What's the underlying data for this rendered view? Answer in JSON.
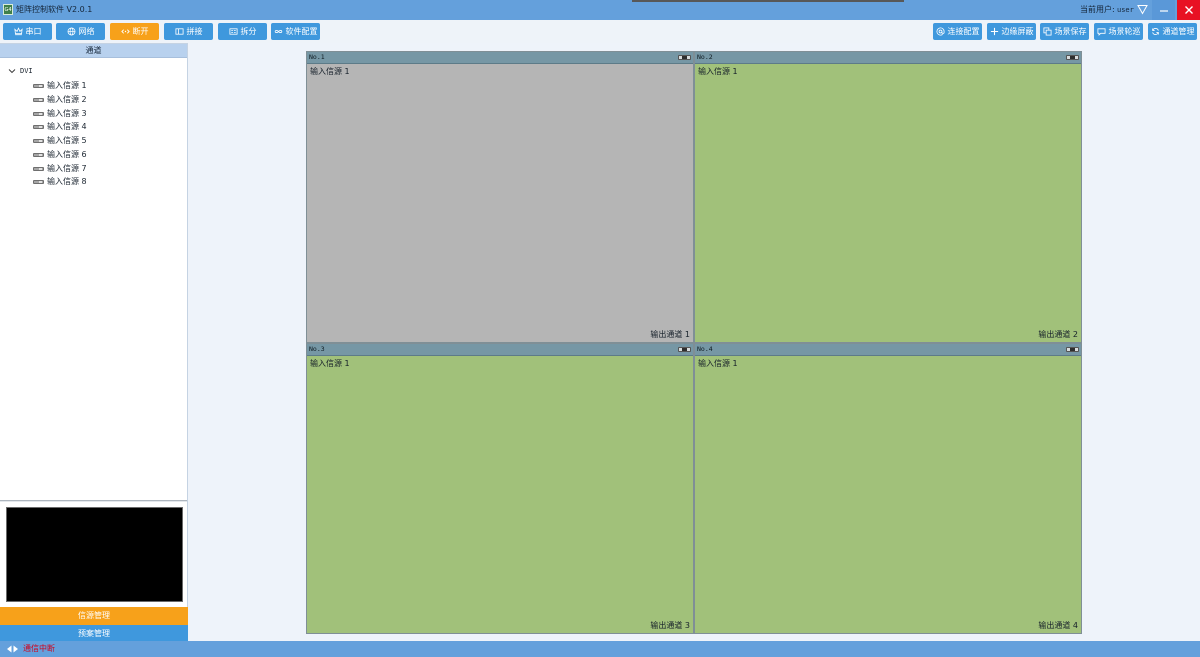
{
  "app": {
    "title": "矩阵控制软件 V2.0.1",
    "logo_text": "G4",
    "user_label": "当前用户:",
    "user_name": "user"
  },
  "toolbar": {
    "left": [
      {
        "label": "串口",
        "icon": "crown-icon"
      },
      {
        "label": "网络",
        "icon": "globe-icon"
      },
      {
        "label": "断开",
        "icon": "arrows-horizontal-icon",
        "active": true
      },
      {
        "label": "拼接",
        "icon": "columns-icon"
      },
      {
        "label": "拆分",
        "icon": "split-lines-icon"
      },
      {
        "label": "软件配置",
        "icon": "infinity-link-icon"
      }
    ],
    "right": [
      {
        "label": "连接配置",
        "icon": "at-icon"
      },
      {
        "label": "边缘屏蔽",
        "icon": "plus-icon"
      },
      {
        "label": "场景保存",
        "icon": "copy-icon"
      },
      {
        "label": "场景轮巡",
        "icon": "message-icon"
      },
      {
        "label": "通道管理",
        "icon": "refresh-icon"
      }
    ]
  },
  "sidebar": {
    "header": "通道",
    "tree": {
      "root": "DVI",
      "expanded": true,
      "items": [
        "输入信源 1",
        "输入信源 2",
        "输入信源 3",
        "输入信源 4",
        "输入信源 5",
        "输入信源 6",
        "输入信源 7",
        "输入信源 8"
      ]
    },
    "source_manage_label": "信源管理",
    "plan_manage_label": "预案管理"
  },
  "video_wall": {
    "windows": [
      {
        "number": "No.1",
        "input": "输入信源 1",
        "output": "输出通道 1",
        "fill": "#b5b5b5"
      },
      {
        "number": "No.2",
        "input": "输入信源 1",
        "output": "输出通道 2",
        "fill": "#a1c17a"
      },
      {
        "number": "No.3",
        "input": "输入信源 1",
        "output": "输出通道 3",
        "fill": "#a1c17a"
      },
      {
        "number": "No.4",
        "input": "输入信源 1",
        "output": "输出通道 4",
        "fill": "#a1c17a"
      }
    ]
  },
  "status_bar": {
    "connection_status": "通信中断",
    "status_color": "#d0021b"
  },
  "colors": {
    "title_bar": "#64a0dc",
    "button_blue": "#3f98dd",
    "button_orange": "#f7a11a",
    "close_red": "#e81123",
    "window_header": "#7697a5"
  }
}
